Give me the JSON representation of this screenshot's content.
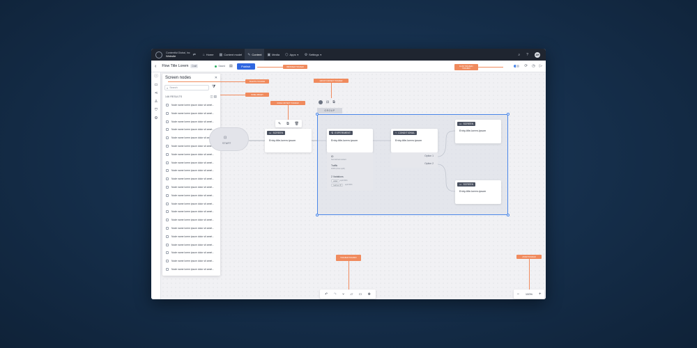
{
  "topnav": {
    "org_name": "Contentful Global, Inc",
    "site_name": "Website",
    "items": [
      {
        "label": "Home",
        "icon": "⌂"
      },
      {
        "label": "Content model",
        "icon": "▦"
      },
      {
        "label": "Content",
        "icon": "✎"
      },
      {
        "label": "Media",
        "icon": "▣"
      },
      {
        "label": "Apps",
        "icon": "⬡"
      },
      {
        "label": "Settings",
        "icon": "⚙"
      }
    ],
    "user_initials": "AH"
  },
  "flowbar": {
    "title": "Flow Title Lorem",
    "badge": "Draft",
    "saved": "Saved",
    "publish": "Publish"
  },
  "panel": {
    "title": "Screen nodes",
    "search_placeholder": "Search",
    "results": "146 RESULTS",
    "item_label": "Node name lorem ipsum dolor sit amet..."
  },
  "annotations": {
    "browser_toolbar": "BROWSER TOOLBAR",
    "palette_toolbar": "PALETTE TOOLBAR",
    "flow_toolbar": "FLOW TOOLBAR / TOOLBOX",
    "group_context": "GROUP CONTEXT TOOLBAR",
    "node_context": "NODE CONTEXT TOOLBAR",
    "node_library": "NODE LIBRARY",
    "toolbar_bottom": "TOOLBAR TOOLBOX",
    "zoom_toolbar": "ZOOM TOOLBAR"
  },
  "graph": {
    "start_label": "START",
    "group_label": "GROUP",
    "screen_tag": "SCREEN",
    "experiment_tag": "EXPERIMENT",
    "conditional_tag": "CONDITIONAL",
    "entry_text": "Entry-title-lorem-ipsum",
    "experiment": {
      "id": "ID",
      "id_sub": "Not defined variant",
      "traffic": "Traffic",
      "traffic_sub": "100% (Free split)",
      "variations": "2 Variations",
      "chip1": "variant",
      "chip1_b": "split 50%",
      "chip2": "treatment B",
      "chip2_b": "split 50%"
    },
    "option1": "Option 1",
    "option2": "Option 2"
  },
  "zoom": {
    "level": "100%"
  },
  "colors": {
    "accent": "#2f66e0",
    "annotation": "#f08a5d",
    "selection": "#4a86e8"
  }
}
